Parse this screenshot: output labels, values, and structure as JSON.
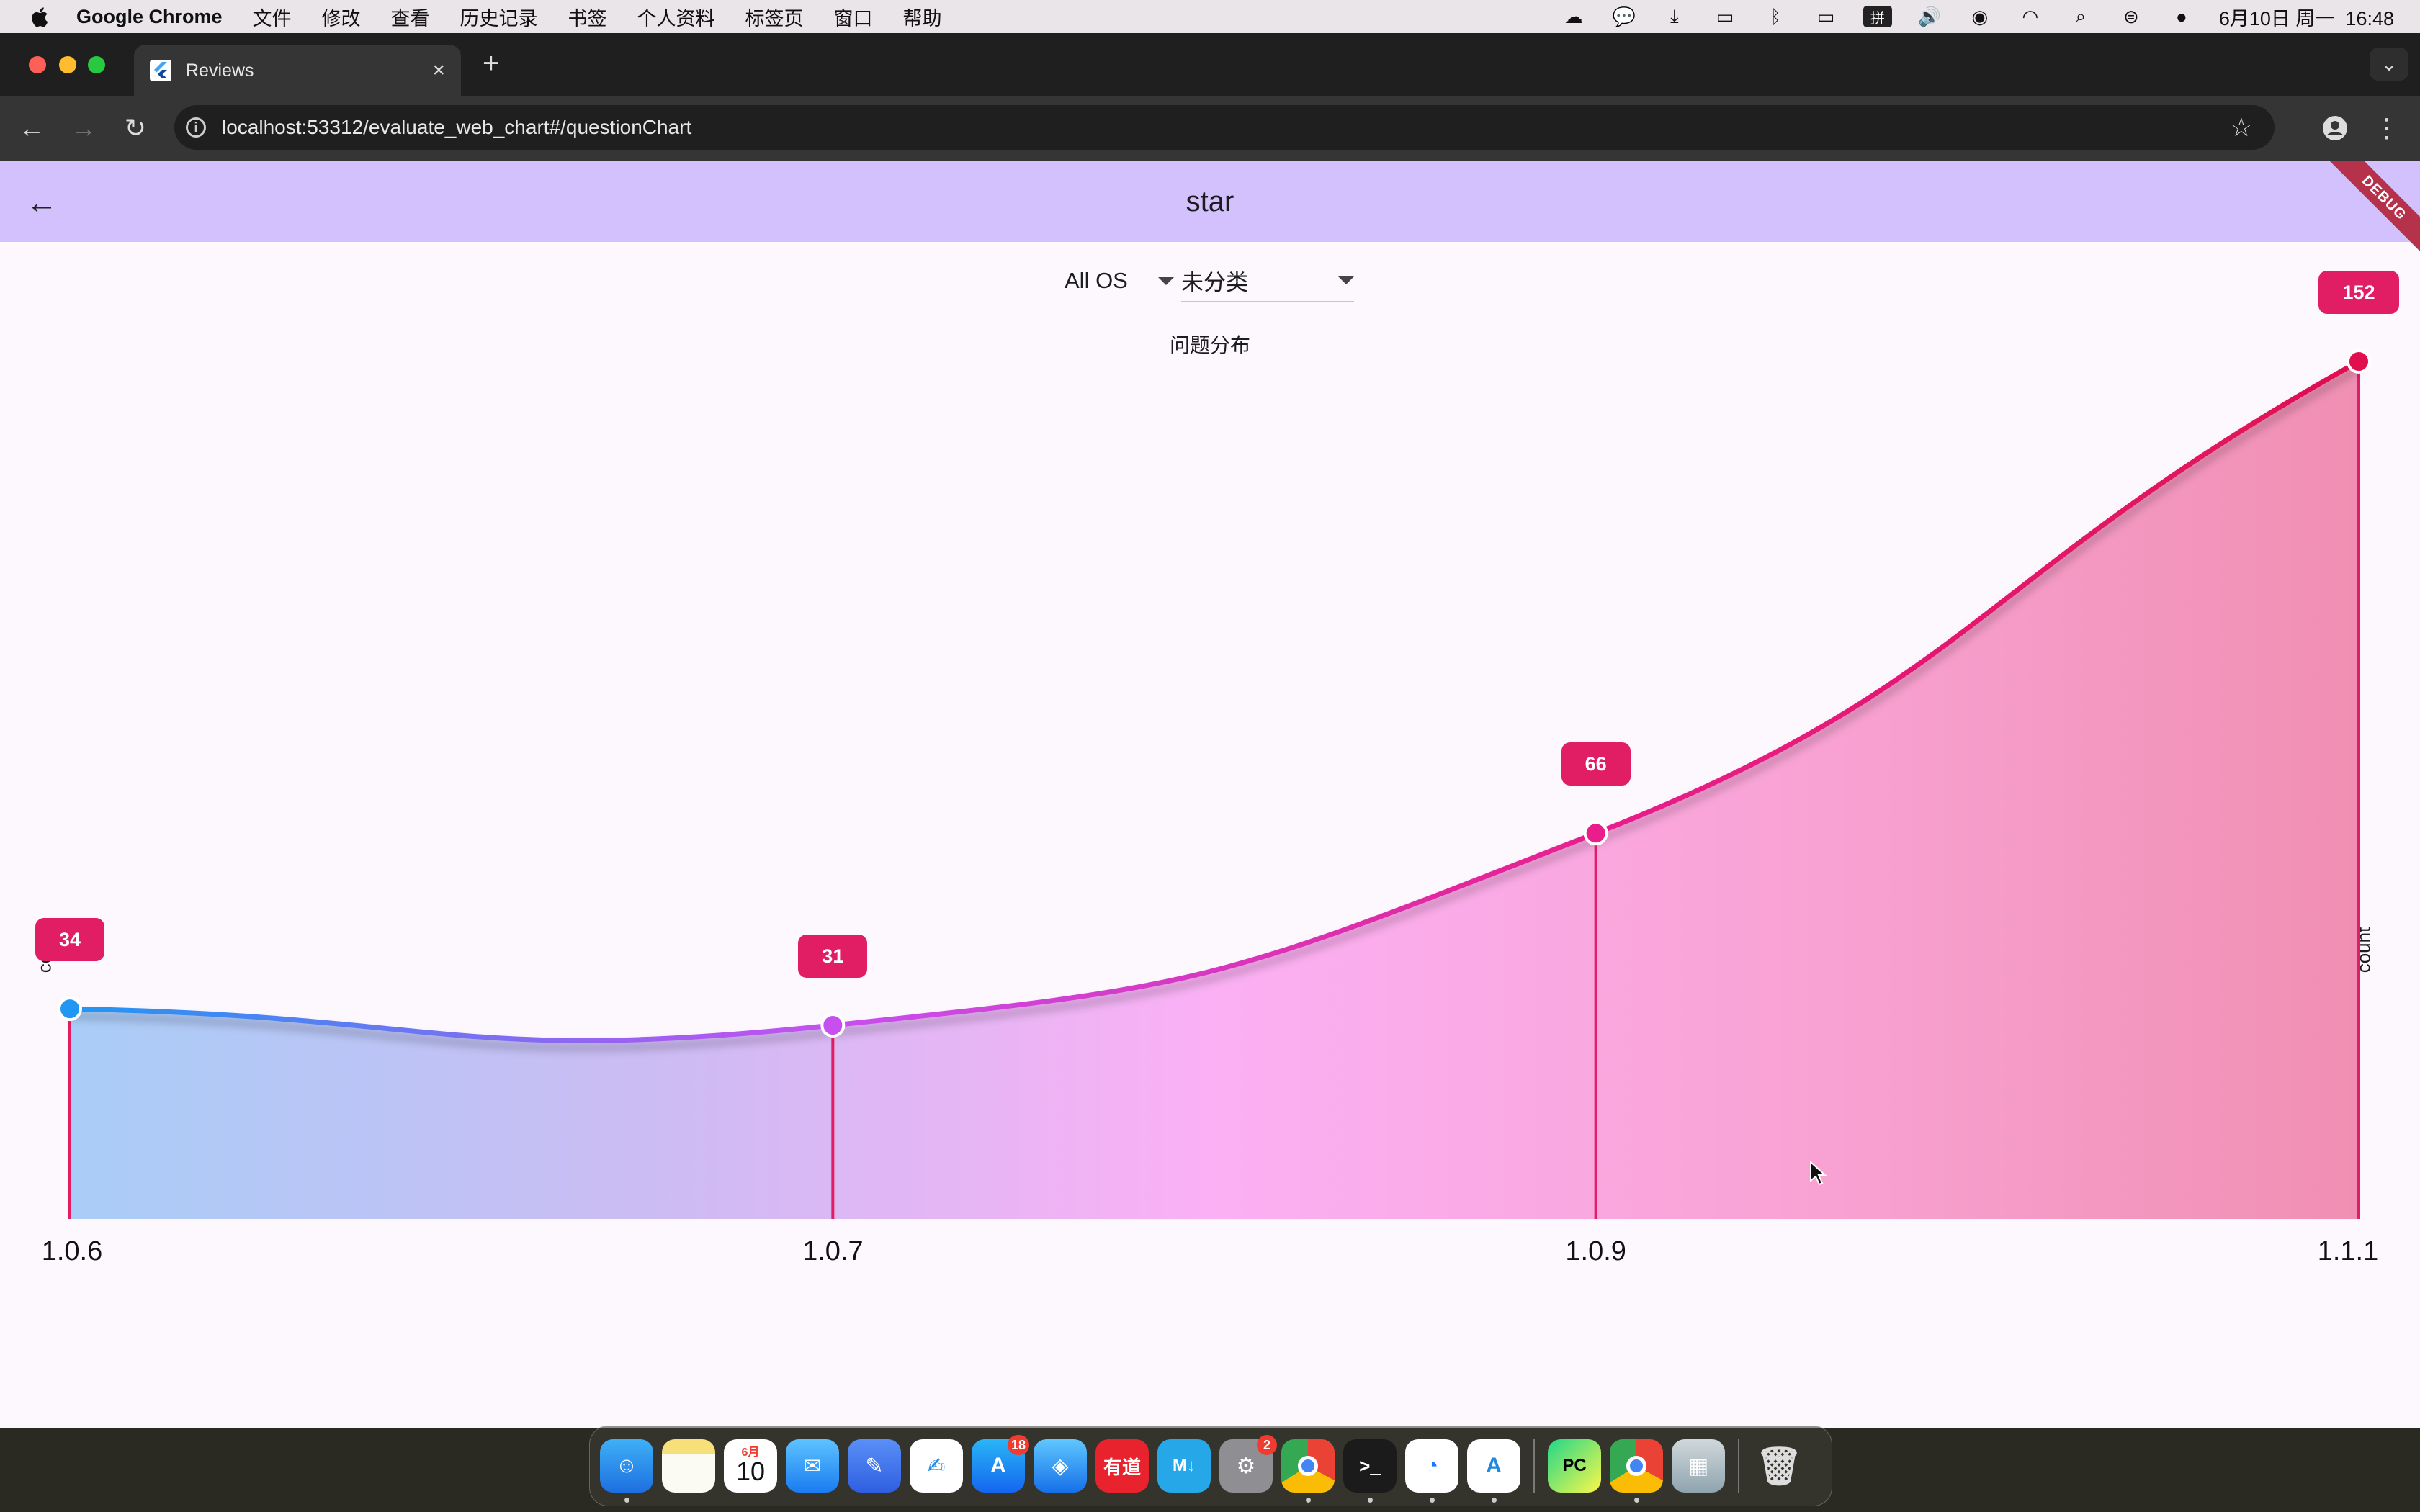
{
  "menubar": {
    "app_name": "Google Chrome",
    "items": [
      "文件",
      "修改",
      "查看",
      "历史记录",
      "书签",
      "个人资料",
      "标签页",
      "窗口",
      "帮助"
    ],
    "ime": "拼",
    "clock": "6月10日 周一  16:48"
  },
  "browser": {
    "tab_title": "Reviews",
    "url": "localhost:53312/evaluate_web_chart#/questionChart"
  },
  "app": {
    "title": "star",
    "debug_banner": "DEBUG",
    "os_filter": "All OS",
    "category_filter": "未分类"
  },
  "chart_data": {
    "type": "area",
    "title": "问题分布",
    "xlabel": "",
    "ylabel": "count",
    "y2label": "count",
    "categories": [
      "1.0.6",
      "1.0.7",
      "1.0.9",
      "1.1.1"
    ],
    "values": [
      34,
      31,
      66,
      152
    ],
    "point_colors": [
      "#2196f3",
      "#c74ff0",
      "#e91e8c",
      "#e0104f"
    ],
    "label_color": "#e11d63",
    "grid": false,
    "legend": "none"
  },
  "dock": {
    "calendar_month": "6月",
    "calendar_day": "10",
    "appstore_badge": "18",
    "settings_badge": "2",
    "youdao_label": "有道",
    "pycharm_label": "PC"
  }
}
